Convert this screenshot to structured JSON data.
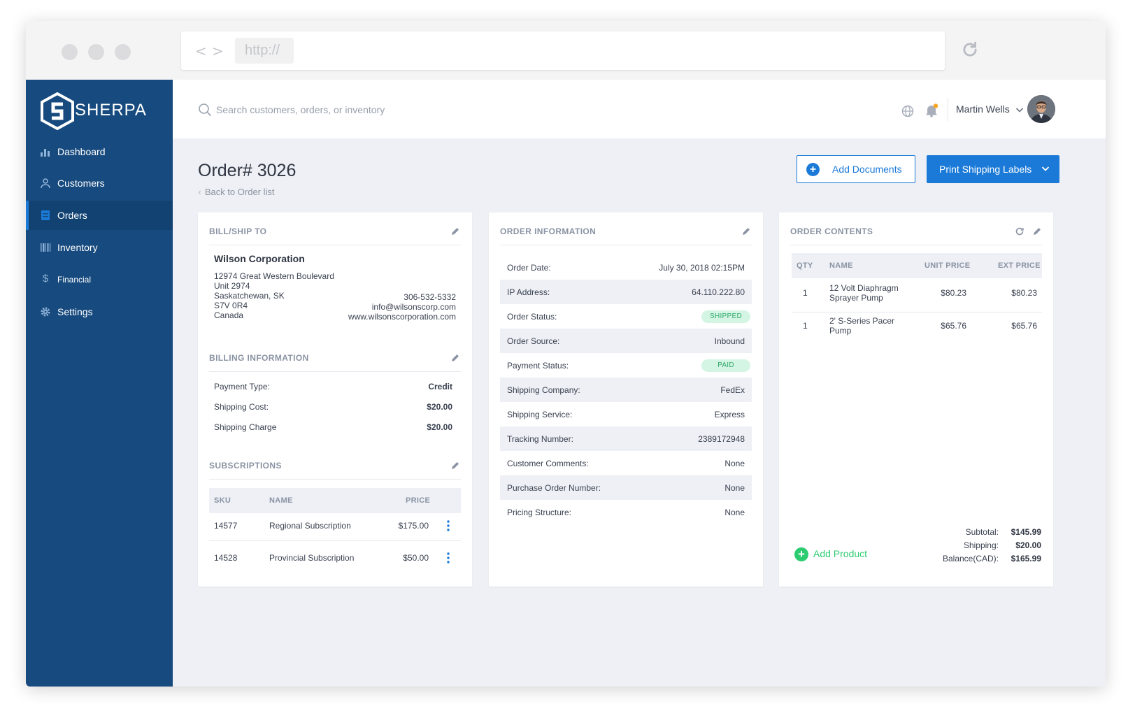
{
  "browser": {
    "url": "http://",
    "back_glyph": "<",
    "forward_glyph": ">"
  },
  "sidebar": {
    "brand": "SHERPA",
    "items": [
      {
        "label": "Dashboard",
        "icon": "bar-chart-icon"
      },
      {
        "label": "Customers",
        "icon": "user-icon"
      },
      {
        "label": "Orders",
        "icon": "list-icon",
        "active": true
      },
      {
        "label": "Inventory",
        "icon": "barcode-icon"
      },
      {
        "label": "Financial",
        "icon": "dollar-icon"
      },
      {
        "label": "Settings",
        "icon": "gear-icon"
      }
    ]
  },
  "topbar": {
    "search_placeholder": "Search customers, orders, or inventory",
    "user_name": "Martin Wells"
  },
  "page": {
    "title": "Order# 3026",
    "back_label": "Back to Order list",
    "add_documents": "Add Documents",
    "print_labels": "Print Shipping Labels"
  },
  "bill_ship": {
    "title": "BILL/SHIP TO",
    "company": "Wilson Corporation",
    "address": [
      "12974 Great Western Boulevard",
      "Unit 2974",
      "Saskatchewan, SK",
      "S7V 0R4",
      "Canada"
    ],
    "phone": "306-532-5332",
    "email": "info@wilsonscorp.com",
    "website": "www.wilsonscorporation.com"
  },
  "billing": {
    "title": "BILLING INFORMATION",
    "rows": [
      {
        "label": "Payment Type:",
        "value": "Credit"
      },
      {
        "label": "Shipping Cost:",
        "value": "$20.00"
      },
      {
        "label": "Shipping Charge",
        "value": "$20.00"
      }
    ]
  },
  "subscriptions": {
    "title": "SUBSCRIPTIONS",
    "headers": {
      "sku": "SKU",
      "name": "NAME",
      "price": "PRICE"
    },
    "rows": [
      {
        "sku": "14577",
        "name": "Regional Subscription",
        "price": "$175.00"
      },
      {
        "sku": "14528",
        "name": "Provincial Subscription",
        "price": "$50.00"
      }
    ]
  },
  "order_info": {
    "title": "ORDER INFORMATION",
    "rows": [
      {
        "label": "Order Date:",
        "value": "July 30, 2018 02:15PM"
      },
      {
        "label": "IP Address:",
        "value": "64.110.222.80"
      },
      {
        "label": "Order Status:",
        "value": "SHIPPED"
      },
      {
        "label": "Order Source:",
        "value": "Inbound"
      },
      {
        "label": "Payment Status:",
        "value": "PAID"
      },
      {
        "label": "Shipping Company:",
        "value": "FedEx"
      },
      {
        "label": "Shipping Service:",
        "value": "Express"
      },
      {
        "label": "Tracking Number:",
        "value": "2389172948"
      },
      {
        "label": "Customer Comments:",
        "value": "None"
      },
      {
        "label": "Purchase Order Number:",
        "value": "None"
      },
      {
        "label": "Pricing Structure:",
        "value": "None"
      }
    ]
  },
  "order_contents": {
    "title": "ORDER CONTENTS",
    "headers": {
      "qty": "QTY",
      "name": "NAME",
      "unit_price": "UNIT PRICE",
      "ext_price": "EXT PRICE"
    },
    "rows": [
      {
        "qty": "1",
        "name_1": "12 Volt Diaphragm",
        "name_2": "Sprayer Pump",
        "unit_price": "$80.23",
        "ext_price": "$80.23"
      },
      {
        "qty": "1",
        "name_1": "2' S-Series Pacer",
        "name_2": "Pump",
        "unit_price": "$65.76",
        "ext_price": "$65.76"
      }
    ],
    "add_product": "Add Product",
    "totals": {
      "subtotal_label": "Subtotal:",
      "subtotal": "$145.99",
      "shipping_label": "Shipping:",
      "shipping": "$20.00",
      "balance_label": "Balance(CAD):",
      "balance": "$165.99"
    }
  },
  "colors": {
    "sidebar": "#174a7e",
    "accent": "#1b7ad8",
    "success": "#2ecc71",
    "badge_bg": "#d5f5e4",
    "notify": "#f5a623"
  }
}
